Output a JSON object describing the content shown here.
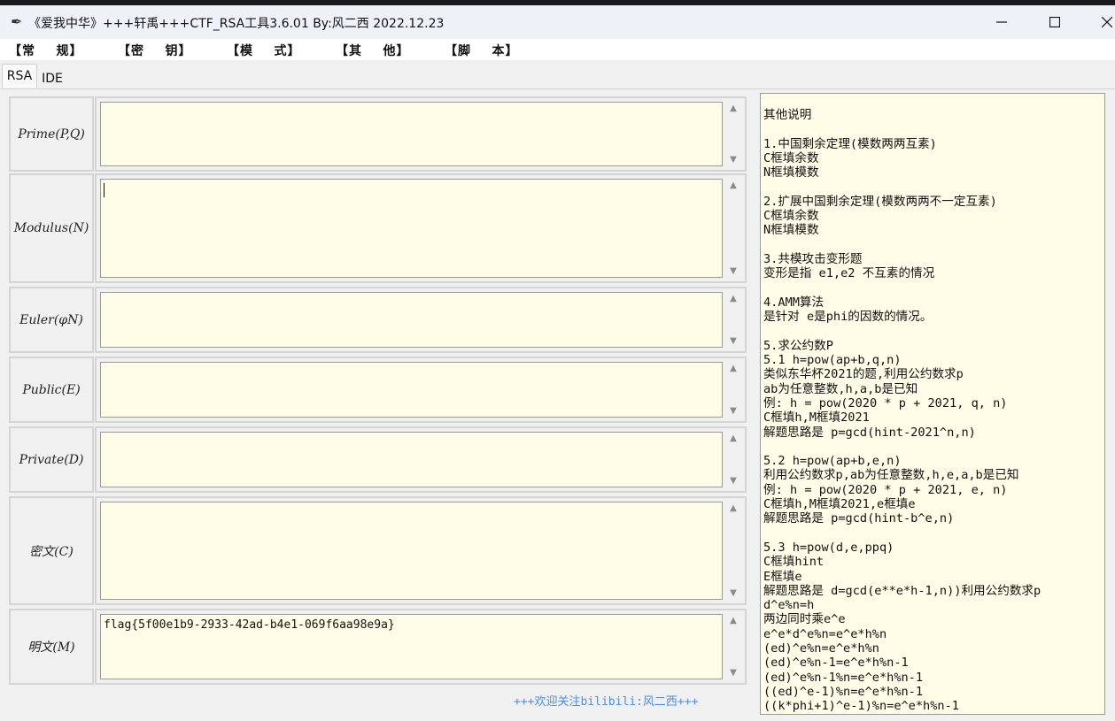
{
  "window": {
    "title": "《爱我中华》+++轩禹+++CTF_RSA工具3.6.01   By:风二西 2022.12.23",
    "icon": "feather-icon",
    "controls": [
      "minimize-icon",
      "maximize-icon",
      "close-icon"
    ]
  },
  "menu": [
    "【常    规】",
    "【密    钥】",
    "【模    式】",
    "【其    他】",
    "【脚    本】"
  ],
  "tabs": [
    "RSA",
    "IDE"
  ],
  "active_tab": "RSA",
  "fields": [
    {
      "label": "Prime(P,Q)",
      "value": ""
    },
    {
      "label": "Modulus(N)",
      "value": ""
    },
    {
      "label": "Euler(φN)",
      "value": ""
    },
    {
      "label": "Public(E)",
      "value": ""
    },
    {
      "label": "Private(D)",
      "value": ""
    },
    {
      "label": "密文(C)",
      "value": ""
    },
    {
      "label": "明文(M)",
      "value": "flag{5f00e1b9-2933-42ad-b4e1-069f6aa98e9a}"
    }
  ],
  "footer": "+++欢迎关注bilibili:风二西+++",
  "notes": "其他说明\n\n1.中国剩余定理(模数两两互素)\nC框填余数\nN框填模数\n\n2.扩展中国剩余定理(模数两两不一定互素)\nC框填余数\nN框填模数\n\n3.共模攻击变形题\n变形是指 e1,e2 不互素的情况\n\n4.AMM算法\n是针对 e是phi的因数的情况。\n\n5.求公约数P\n5.1 h=pow(ap+b,q,n)\n类似东华杯2021的题,利用公约数求p\nab为任意整数,h,a,b是已知\n例: h = pow(2020 * p + 2021, q, n)\nC框填h,M框填2021\n解题思路是 p=gcd(hint-2021^n,n)\n\n5.2 h=pow(ap+b,e,n)\n利用公约数求p,ab为任意整数,h,e,a,b是已知\n例: h = pow(2020 * p + 2021, e, n)\nC框填h,M框填2021,e框填e\n解题思路是 p=gcd(hint-b^e,n)\n\n5.3 h=pow(d,e,ppq)\nC框填hint\nE框填e\n解题思路是 d=gcd(e**e*h-1,n))利用公约数求p\nd^e%n=h\n两边同时乘e^e\ne^e*d^e%n=e^e*h%n\n(ed)^e%n=e^e*h%n\n(ed)^e%n-1=e^e*h%n-1\n(ed)^e%n-1%n=e^e*h%n-1\n((ed)^e-1)%n=e^e*h%n-1\n((k*phi+1)^e-1)%n=e^e*h%n-1"
}
